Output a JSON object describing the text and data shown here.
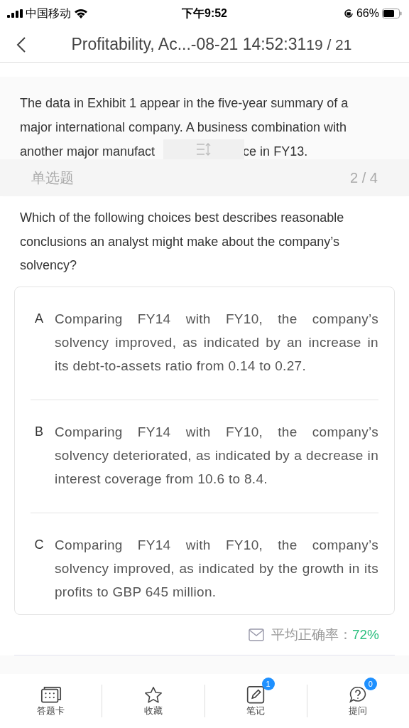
{
  "status_bar": {
    "carrier": "中国移动",
    "time": "下午9:52",
    "battery": "66%"
  },
  "header": {
    "title": "Profitability, Ac...-08-21 14:52:31",
    "counter": "19 / 21"
  },
  "passage": {
    "lines": [
      "The data in Exhibit 1 appear in the five-year summary of a",
      "major international company. A business combination with"
    ],
    "last_line_left": "another major manufact",
    "last_line_right": "ce in FY13."
  },
  "question_bar": {
    "type": "单选题",
    "progress": "2 / 4"
  },
  "question": "Which of the following choices best describes reasonable conclusions an analyst might make about the company’s solvency?",
  "options": [
    {
      "letter": "A",
      "text": "Comparing FY14 with FY10, the company’s solvency improved, as indicated by an increase in its debt-to-assets ratio from 0.14 to 0.27."
    },
    {
      "letter": "B",
      "text": "Comparing FY14 with FY10, the company’s solvency deteriorated, as indicated by a decrease in interest coverage from 10.6 to 8.4."
    },
    {
      "letter": "C",
      "text": "Comparing FY14 with FY10, the company’s solvency improved, as indicated by the growth in its profits to GBP 645 million."
    }
  ],
  "accuracy": {
    "label": "平均正确率：",
    "value": "72%"
  },
  "tab_bar": [
    {
      "kind": "card",
      "label": "答题卡"
    },
    {
      "kind": "star",
      "label": "收藏"
    },
    {
      "kind": "note",
      "label": "笔记",
      "badge": "1"
    },
    {
      "kind": "ask",
      "label": "提问",
      "badge": "0"
    }
  ]
}
